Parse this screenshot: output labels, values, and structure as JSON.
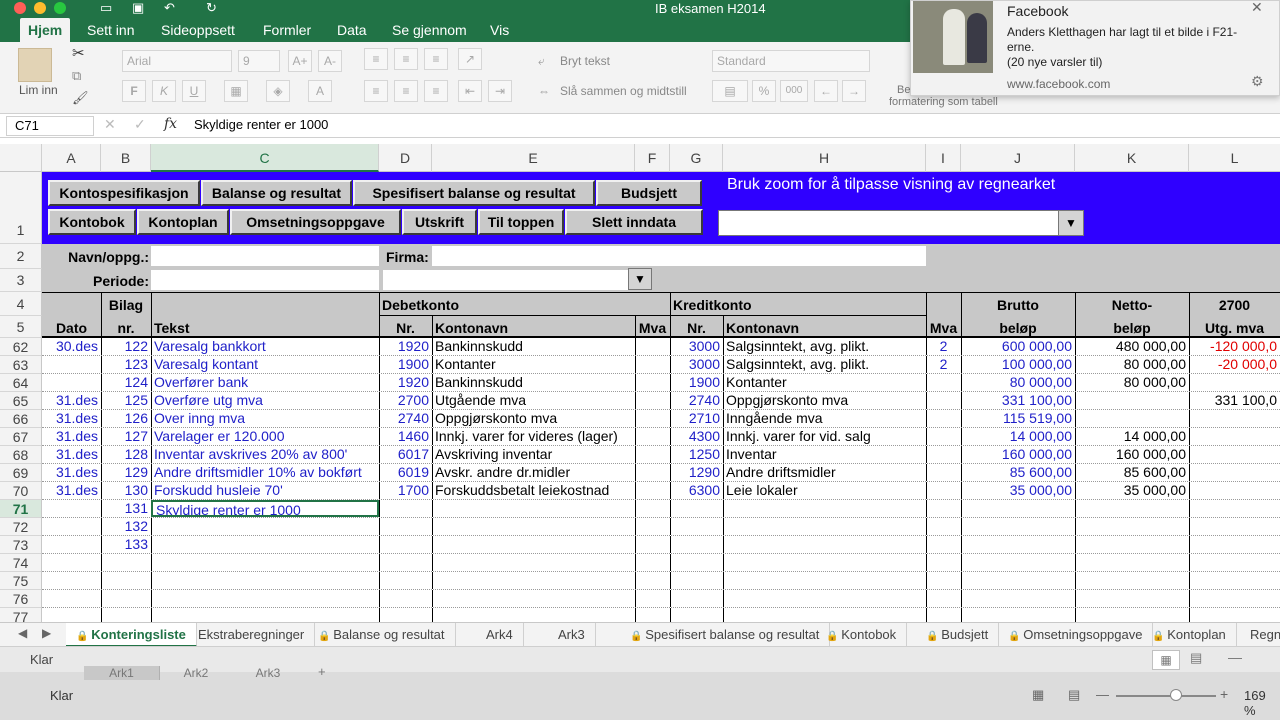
{
  "app": {
    "title": "IB eksamen H2014",
    "accent": "#217346",
    "band_color": "#2f00ff"
  },
  "menu": {
    "tabs": [
      "Hjem",
      "Sett inn",
      "Sideoppsett",
      "Formler",
      "Data",
      "Se gjennom",
      "Vis"
    ]
  },
  "ribbon": {
    "paste_label": "Lim inn",
    "font_name": "Arial",
    "font_size": "9",
    "wrap_text": "Bryt tekst",
    "merge_center": "Slå sammen og midtstill",
    "number_format": "Standard",
    "percent": "%",
    "thousands": "000",
    "format_table": "formatering  som tabell",
    "be_label": "Be"
  },
  "formula_bar": {
    "name_box": "C71",
    "fx": "fx",
    "formula": "Skyldige renter er 1000"
  },
  "columns": [
    "A",
    "B",
    "C",
    "D",
    "E",
    "F",
    "G",
    "H",
    "I",
    "J",
    "K",
    "L"
  ],
  "band": {
    "buttons_row1": [
      "Kontospesifikasjon",
      "Balanse og resultat",
      "Spesifisert balanse og resultat",
      "Budsjett"
    ],
    "buttons_row2": [
      "Kontobok",
      "Kontoplan",
      "Omsetningsoppgave",
      "Utskrift",
      "Til toppen",
      "Slett inndata"
    ],
    "zoom_hint": "Bruk zoom for å tilpasse visning av regnearket",
    "row_number": "1"
  },
  "form": {
    "name_label": "Navn/oppg.:",
    "period_label": "Periode:",
    "company_label": "Firma:",
    "row2": "2",
    "row3": "3"
  },
  "headers": {
    "row4": "4",
    "row5": "5",
    "bilag": "Bilag",
    "dato": "Dato",
    "nr": "nr.",
    "tekst": "Tekst",
    "debetkonto": "Debetkonto",
    "kreditkonto": "Kreditkonto",
    "debet_nr": "Nr.",
    "debet_navn": "Kontonavn",
    "mva": "Mva",
    "kredit_nr": "Nr.",
    "kredit_navn": "Kontonavn",
    "kredit_mva": "Mva",
    "brutto": "Brutto",
    "belop": "beløp",
    "netto": "Netto-",
    "netto_belop": "beløp",
    "utg_code": "2700",
    "utg_mva": "Utg. mva"
  },
  "rows": [
    {
      "row": "62",
      "dato": "30.des",
      "bilag": "122",
      "tekst": "Varesalg bankkort",
      "dnr": "1920",
      "dnavn": "Bankinnskudd",
      "dmva": "",
      "knr": "3000",
      "knavn": "Salgsinntekt, avg. plikt.",
      "kmva": "2",
      "brutto": "600 000,00",
      "netto": "480 000,00",
      "utg": "-120 000,0"
    },
    {
      "row": "63",
      "dato": "",
      "bilag": "123",
      "tekst": "Varesalg kontant",
      "dnr": "1900",
      "dnavn": "Kontanter",
      "dmva": "",
      "knr": "3000",
      "knavn": "Salgsinntekt, avg. plikt.",
      "kmva": "2",
      "brutto": "100 000,00",
      "netto": "80 000,00",
      "utg": "-20 000,0"
    },
    {
      "row": "64",
      "dato": "",
      "bilag": "124",
      "tekst": "Overfører bank",
      "dnr": "1920",
      "dnavn": "Bankinnskudd",
      "dmva": "",
      "knr": "1900",
      "knavn": "Kontanter",
      "kmva": "",
      "brutto": "80 000,00",
      "netto": "80 000,00",
      "utg": ""
    },
    {
      "row": "65",
      "dato": "31.des",
      "bilag": "125",
      "tekst": "Overføre utg mva",
      "dnr": "2700",
      "dnavn": "Utgående mva",
      "dmva": "",
      "knr": "2740",
      "knavn": "Oppgjørskonto mva",
      "kmva": "",
      "brutto": "331 100,00",
      "netto": "",
      "utg": "331 100,0"
    },
    {
      "row": "66",
      "dato": "31.des",
      "bilag": "126",
      "tekst": "Over inng mva",
      "dnr": "2740",
      "dnavn": "Oppgjørskonto mva",
      "dmva": "",
      "knr": "2710",
      "knavn": "Inngående mva",
      "kmva": "",
      "brutto": "115 519,00",
      "netto": "",
      "utg": ""
    },
    {
      "row": "67",
      "dato": "31.des",
      "bilag": "127",
      "tekst": "Varelager er 120.000",
      "dnr": "1460",
      "dnavn": "Innkj. varer for videres (lager)",
      "dmva": "",
      "knr": "4300",
      "knavn": "Innkj. varer for vid. salg",
      "kmva": "",
      "brutto": "14 000,00",
      "netto": "14 000,00",
      "utg": ""
    },
    {
      "row": "68",
      "dato": "31.des",
      "bilag": "128",
      "tekst": "Inventar avskrives 20% av 800'",
      "dnr": "6017",
      "dnavn": "Avskriving inventar",
      "dmva": "",
      "knr": "1250",
      "knavn": "Inventar",
      "kmva": "",
      "brutto": "160 000,00",
      "netto": "160 000,00",
      "utg": ""
    },
    {
      "row": "69",
      "dato": "31.des",
      "bilag": "129",
      "tekst": "Andre driftsmidler 10% av bokført",
      "dnr": "6019",
      "dnavn": "Avskr. andre dr.midler",
      "dmva": "",
      "knr": "1290",
      "knavn": "Andre driftsmidler",
      "kmva": "",
      "brutto": "85 600,00",
      "netto": "85 600,00",
      "utg": ""
    },
    {
      "row": "70",
      "dato": "31.des",
      "bilag": "130",
      "tekst": "Forskudd husleie 70'",
      "dnr": "1700",
      "dnavn": "Forskuddsbetalt leiekostnad",
      "dmva": "",
      "knr": "6300",
      "knavn": "Leie lokaler",
      "kmva": "",
      "brutto": "35 000,00",
      "netto": "35 000,00",
      "utg": ""
    },
    {
      "row": "71",
      "dato": "",
      "bilag": "131",
      "tekst": "Skyldige renter er 1000",
      "dnr": "",
      "dnavn": "",
      "dmva": "",
      "knr": "",
      "knavn": "",
      "kmva": "",
      "brutto": "",
      "netto": "",
      "utg": ""
    },
    {
      "row": "72",
      "dato": "",
      "bilag": "132",
      "tekst": "",
      "dnr": "",
      "dnavn": "",
      "dmva": "",
      "knr": "",
      "knavn": "",
      "kmva": "",
      "brutto": "",
      "netto": "",
      "utg": ""
    },
    {
      "row": "73",
      "dato": "",
      "bilag": "133",
      "tekst": "",
      "dnr": "",
      "dnavn": "",
      "dmva": "",
      "knr": "",
      "knavn": "",
      "kmva": "",
      "brutto": "",
      "netto": "",
      "utg": ""
    },
    {
      "row": "74",
      "dato": "",
      "bilag": "",
      "tekst": "",
      "dnr": "",
      "dnavn": "",
      "dmva": "",
      "knr": "",
      "knavn": "",
      "kmva": "",
      "brutto": "",
      "netto": "",
      "utg": ""
    },
    {
      "row": "75",
      "dato": "",
      "bilag": "",
      "tekst": "",
      "dnr": "",
      "dnavn": "",
      "dmva": "",
      "knr": "",
      "knavn": "",
      "kmva": "",
      "brutto": "",
      "netto": "",
      "utg": ""
    },
    {
      "row": "76",
      "dato": "",
      "bilag": "",
      "tekst": "",
      "dnr": "",
      "dnavn": "",
      "dmva": "",
      "knr": "",
      "knavn": "",
      "kmva": "",
      "brutto": "",
      "netto": "",
      "utg": ""
    },
    {
      "row": "77",
      "dato": "",
      "bilag": "",
      "tekst": "",
      "dnr": "",
      "dnavn": "",
      "dmva": "",
      "knr": "",
      "knavn": "",
      "kmva": "",
      "brutto": "",
      "netto": "",
      "utg": ""
    }
  ],
  "sheet_tabs": [
    {
      "label": "Konteringsliste",
      "locked": true,
      "active": true
    },
    {
      "label": "Ekstraberegninger",
      "locked": false,
      "active": false
    },
    {
      "label": "Balanse og resultat",
      "locked": true,
      "active": false
    },
    {
      "label": "Ark4",
      "locked": false,
      "active": false
    },
    {
      "label": "Ark3",
      "locked": false,
      "active": false
    },
    {
      "label": "Spesifisert balanse og resultat",
      "locked": true,
      "active": false
    },
    {
      "label": "Kontobok",
      "locked": true,
      "active": false
    },
    {
      "label": "Budsjett",
      "locked": true,
      "active": false
    },
    {
      "label": "Omsetningsoppgave",
      "locked": true,
      "active": false
    },
    {
      "label": "Kontoplan",
      "locked": true,
      "active": false
    },
    {
      "label": "Regns",
      "locked": false,
      "active": false
    }
  ],
  "status": {
    "ready": "Klar",
    "ready2": "Klar",
    "zoom": "169 %",
    "back_tabs": [
      "Ark1",
      "Ark2",
      "Ark3"
    ]
  },
  "notification": {
    "app": "Facebook",
    "message": "Anders Kletthagen har lagt til et bilde i F21-erne.",
    "count": "(20 nye varsler til)",
    "url": "www.facebook.com"
  }
}
